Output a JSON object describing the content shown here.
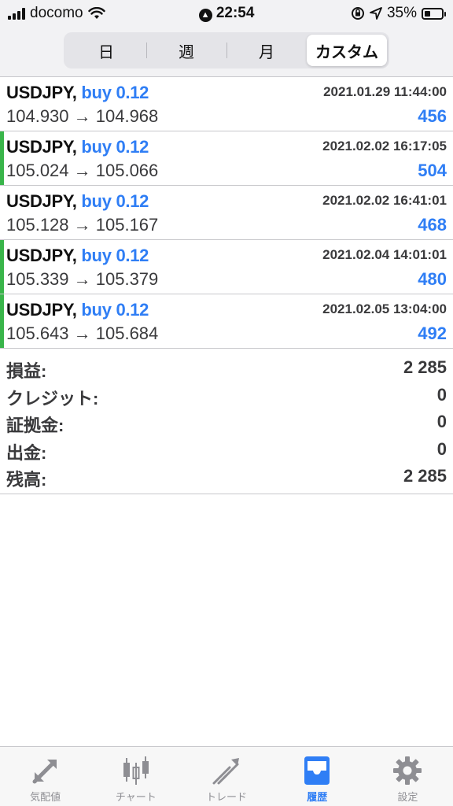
{
  "status": {
    "carrier": "docomo",
    "time": "22:54",
    "battery": "35%",
    "battery_level": 0.35
  },
  "segments": [
    {
      "label": "日",
      "active": false
    },
    {
      "label": "週",
      "active": false
    },
    {
      "label": "月",
      "active": false
    },
    {
      "label": "カスタム",
      "active": true
    }
  ],
  "trades": [
    {
      "symbol": "USDJPY,",
      "side": "buy 0.12",
      "time": "2021.01.29 11:44:00",
      "prices": "104.930 → 104.968",
      "profit": "456",
      "marked": false
    },
    {
      "symbol": "USDJPY,",
      "side": "buy 0.12",
      "time": "2021.02.02 16:17:05",
      "prices": "105.024 → 105.066",
      "profit": "504",
      "marked": true
    },
    {
      "symbol": "USDJPY,",
      "side": "buy 0.12",
      "time": "2021.02.02 16:41:01",
      "prices": "105.128 → 105.167",
      "profit": "468",
      "marked": false
    },
    {
      "symbol": "USDJPY,",
      "side": "buy 0.12",
      "time": "2021.02.04 14:01:01",
      "prices": "105.339 → 105.379",
      "profit": "480",
      "marked": true
    },
    {
      "symbol": "USDJPY,",
      "side": "buy 0.12",
      "time": "2021.02.05 13:04:00",
      "prices": "105.643 → 105.684",
      "profit": "492",
      "marked": true
    }
  ],
  "summary": [
    {
      "label": "損益:",
      "value": "2 285"
    },
    {
      "label": "クレジット:",
      "value": "0"
    },
    {
      "label": "証拠金:",
      "value": "0"
    },
    {
      "label": "出金:",
      "value": "0"
    },
    {
      "label": "残高:",
      "value": "2 285"
    }
  ],
  "tabs": [
    {
      "label": "気配値",
      "icon": "quotes-arrows-icon",
      "active": false
    },
    {
      "label": "チャート",
      "icon": "candlestick-chart-icon",
      "active": false
    },
    {
      "label": "トレード",
      "icon": "trade-trend-icon",
      "active": false
    },
    {
      "label": "履歴",
      "icon": "history-inbox-icon",
      "active": true
    },
    {
      "label": "設定",
      "icon": "gear-icon",
      "active": false
    }
  ],
  "colors": {
    "accent": "#2f7ef5",
    "marker": "#39b54a",
    "inactive": "#8e8e93"
  }
}
